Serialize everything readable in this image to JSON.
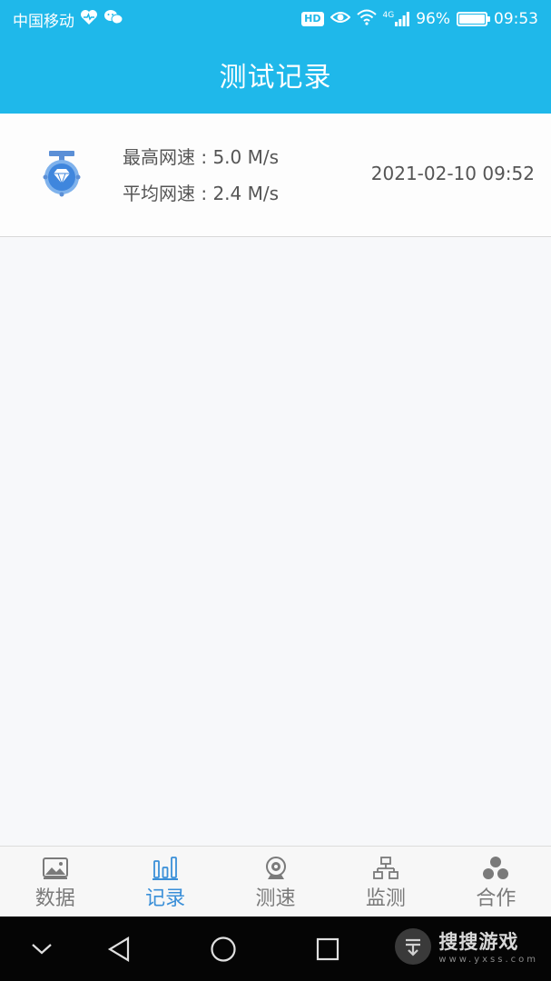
{
  "status_bar": {
    "carrier": "中国移动",
    "battery": "96%",
    "time": "09:53",
    "network": "4G",
    "hd": "HD"
  },
  "header": {
    "title": "测试记录"
  },
  "records": [
    {
      "max_speed": "最高网速 : 5.0 M/s",
      "avg_speed": "平均网速 : 2.4 M/s",
      "datetime": "2021-02-10 09:52"
    }
  ],
  "tabs": [
    {
      "label": "数据",
      "icon": "image-icon"
    },
    {
      "label": "记录",
      "icon": "bar-chart-icon",
      "active": true
    },
    {
      "label": "测速",
      "icon": "webcam-icon"
    },
    {
      "label": "监测",
      "icon": "network-tree-icon"
    },
    {
      "label": "合作",
      "icon": "cooperate-icon"
    }
  ],
  "watermark": {
    "main": "搜搜游戏",
    "sub": "www.yxss.com"
  },
  "colors": {
    "header": "#1fb8ea",
    "active_tab": "#3a8fd8",
    "inactive_tab": "#7a7a7a"
  }
}
